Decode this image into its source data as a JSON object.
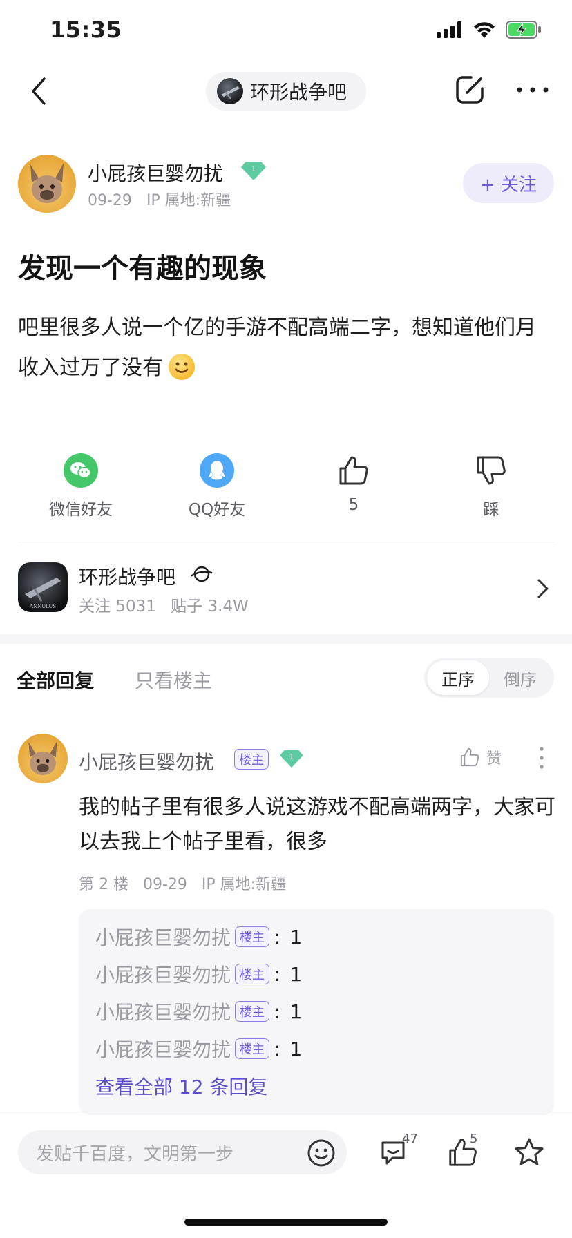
{
  "status_bar": {
    "time": "15:35"
  },
  "nav": {
    "forum_name": "环形战争吧",
    "forum_logo_text": "ANNULUS"
  },
  "author": {
    "name": "小屁孩巨婴勿扰",
    "level": "1",
    "date": "09-29",
    "ip": "IP 属地:新疆",
    "follow_label": "+ 关注"
  },
  "post": {
    "title": "发现一个有趣的现象",
    "body": "吧里很多人说一个亿的手游不配高端二字，想知道他们月收入过万了没有"
  },
  "actions": {
    "wechat_label": "微信好友",
    "qq_label": "QQ好友",
    "like_count": "5",
    "dislike_label": "踩"
  },
  "forum_card": {
    "name": "环形战争吧",
    "followers": "关注 5031",
    "posts": "贴子 3.4W"
  },
  "reply_tabs": {
    "all": "全部回复",
    "op_only": "只看楼主",
    "sort_asc": "正序",
    "sort_desc": "倒序"
  },
  "reply": {
    "name": "小屁孩巨婴勿扰",
    "badge": "楼主",
    "level": "1",
    "like_label": "赞",
    "body": "我的帖子里有很多人说这游戏不配高端两字，大家可以去我上个帖子里看，很多",
    "floor": "第 2 楼",
    "date": "09-29",
    "ip": "IP 属地:新疆",
    "sub_replies": [
      {
        "name": "小屁孩巨婴勿扰",
        "badge": "楼主",
        "text": "1"
      },
      {
        "name": "小屁孩巨婴勿扰",
        "badge": "楼主",
        "text": "1"
      },
      {
        "name": "小屁孩巨婴勿扰",
        "badge": "楼主",
        "text": "1"
      },
      {
        "name": "小屁孩巨婴勿扰",
        "badge": "楼主",
        "text": "1"
      }
    ],
    "view_all": "查看全部 12 条回复"
  },
  "bottom_bar": {
    "input_placeholder": "发贴千百度，文明第一步",
    "comment_count": "47",
    "like_count": "5"
  },
  "colors": {
    "accent": "#6c5cdc",
    "wechat": "#43c768",
    "qq": "#4ea8f5",
    "level_badge": "#5ccca0"
  }
}
